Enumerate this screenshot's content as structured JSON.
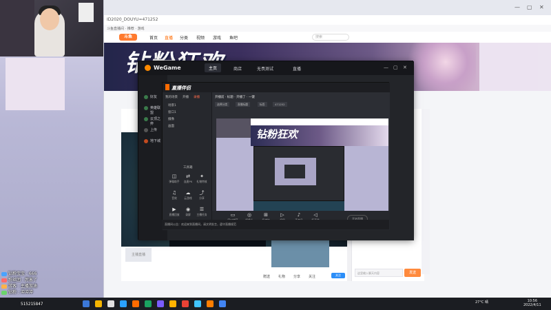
{
  "browser": {
    "address": "ID2020_DOUYU=471252",
    "bookmarks": "斗鱼直播间 · 推荐 · 游戏",
    "window_controls": [
      "—",
      "▢",
      "✕"
    ]
  },
  "site_nav": {
    "logo": "斗鱼",
    "items": [
      "首页",
      "直播",
      "分类",
      "视频",
      "游戏",
      "鱼吧"
    ],
    "active_index": 1,
    "search_placeholder": "搜索"
  },
  "banner": {
    "text": "钻粉狂欢"
  },
  "wegame": {
    "brand": "WeGame",
    "tabs": [
      "主页",
      "商店",
      "无畏测试",
      "直播"
    ],
    "active_tab_index": 0,
    "sidebar_items": [
      "好友",
      "英雄联盟",
      "云顶之弈",
      "上传",
      "地下城"
    ],
    "window_controls": [
      "—",
      "▢",
      "✕"
    ]
  },
  "broadcaster": {
    "logo": "直播伴侣",
    "scene_tabs": [
      "我的场景",
      "开播",
      "录播"
    ],
    "active_scene_tab_index": 2,
    "scenes": [
      "场景1",
      "窗口1",
      "摄像",
      "画面"
    ],
    "tools_title": "工具箱",
    "tools": [
      {
        "label": "弹幕助手",
        "glyph": "◫"
      },
      {
        "label": "连麦PK",
        "glyph": "⇄"
      },
      {
        "label": "礼物特效",
        "glyph": "✦"
      },
      {
        "label": "音效",
        "glyph": "♫"
      },
      {
        "label": "云游戏",
        "glyph": "☁"
      },
      {
        "label": "分享",
        "glyph": "⤴"
      },
      {
        "label": "直播回放",
        "glyph": "▶"
      },
      {
        "label": "录屏",
        "glyph": "◉"
      },
      {
        "label": "主播任务",
        "glyph": "☰"
      }
    ],
    "topbar": "开播前 · 标题 · 开播了 · 一键",
    "chips": [
      "选择分类",
      "直播标题",
      "标签",
      "471252"
    ],
    "bottom_tools": [
      {
        "label": "窗口捕获",
        "glyph": "▭"
      },
      {
        "label": "摄像头",
        "glyph": "◎"
      },
      {
        "label": "多媒体",
        "glyph": "⊞"
      },
      {
        "label": "投屏",
        "glyph": "▷"
      },
      {
        "label": "麦克风",
        "glyph": "♪"
      },
      {
        "label": "扬声器",
        "glyph": "◁"
      }
    ],
    "start_label": "开始直播",
    "footer": "直播间公告：欢迎来到直播间，请文明发言，遵守直播规范"
  },
  "live_page": {
    "mini_label": "主播直播",
    "bottom_labels": [
      "赠送",
      "礼物",
      "分享",
      "关注"
    ],
    "blue_button": "关注",
    "chat_input_placeholder": "这里输入聊天内容",
    "send_label": "发送"
  },
  "chat_overlay": {
    "rows": [
      {
        "text": "钻粉宝宝 : 666",
        "color": "#4aa3ff"
      },
      {
        "text": "粉丝团 : 厉害了",
        "color": "#ff6b6b"
      },
      {
        "text": "游客 : 主播加油",
        "color": "#ffb34a"
      },
      {
        "text": "钻粉 : 冲冲冲",
        "color": "#6bd46b"
      }
    ],
    "viewer_count": "515215847"
  },
  "taskbar": {
    "tray": "27°C 晴",
    "time": "10:56",
    "date": "2022/4/11",
    "icon_colors": [
      "#3c78d8",
      "#f4b400",
      "#e0e0e0",
      "#2aa1ff",
      "#ff6b00",
      "#1aa260",
      "#7a5cff",
      "#ffb300",
      "#e94235",
      "#41c4ff",
      "#ff7e00",
      "#4285f4"
    ]
  }
}
